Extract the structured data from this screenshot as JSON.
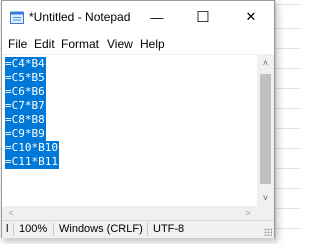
{
  "window": {
    "title": "*Untitled - Notepad",
    "minimize_glyph": "—",
    "maximize_glyph": "☐",
    "close_glyph": "✕"
  },
  "menu": {
    "items": [
      "File",
      "Edit",
      "Format",
      "View",
      "Help"
    ]
  },
  "editor": {
    "lines": [
      "=C4*B4",
      "=C5*B5",
      "=C6*B6",
      "=C7*B7",
      "=C8*B8",
      "=C9*B9",
      "=C10*B10",
      "=C11*B11"
    ],
    "selection_color": "#0078d7"
  },
  "scrollbars": {
    "up_glyph": "˄",
    "down_glyph": "˅",
    "left_glyph": "<",
    "right_glyph": ">"
  },
  "status": {
    "position": "l",
    "zoom": "100%",
    "line_ending": "Windows (CRLF)",
    "encoding": "UTF-8"
  },
  "icons": {
    "app": "notepad-icon",
    "resize": "resize-grip-icon"
  }
}
